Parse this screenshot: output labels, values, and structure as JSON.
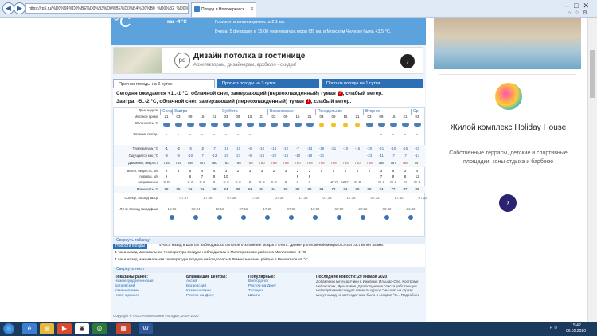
{
  "browser": {
    "url": "https://rp5.ru/%D0%9F%D0%BE%D0%B3%D0%BE%D0%B4%D0%B0_%D0%B2_%D0%9D%D0%BE",
    "tab_title": "Погода в Новочеркасск...",
    "back": "◀",
    "forward": "▶"
  },
  "top": {
    "big_temp": "°C",
    "feels_like": "как -4 °C",
    "visibility": "Горизонтальная видимость 2.1 км.",
    "yesterday": "Вчера, 5 февраля, в 15:00 температура моря (89 км, в Морском Чулеке) была +3.5 °C."
  },
  "ad": {
    "logo": "pd",
    "title": "Дизайн потолка в гостинице",
    "subtitle": "Архитекторам, дизайнерам, архбюро - скидки!",
    "go": "›"
  },
  "tabs": [
    {
      "label": "Прогноз погоды на 6 суток",
      "active": true
    },
    {
      "label": "Прогноз погоды на 3 суток"
    },
    {
      "label": "Прогноз погоды на 1 сутки"
    }
  ],
  "summary": {
    "line1_a": "Сегодня ожидается +1..-1 °С, облачной снег, замерзающий (переохлажденный) туман",
    "line1_b": ", слабый ветер.",
    "line2_a": "Завтра: -5..-2 °С, облачной снег, замерзающий (переохлажденный) туман",
    "line2_b": ", слабый ветер.",
    "warn": "!"
  },
  "grid": {
    "labels": {
      "day": "День недели",
      "time": "Местное время",
      "cloud": "Облачность, %",
      "phen": "Явления погоды",
      "temp": "Температура, °С",
      "feels": "Ощущается как, °С",
      "press": "Давление, мм рт.ст.",
      "wind": "Ветер: скорость, м/с",
      "gust": "порывы, м/с",
      "dir": "направление",
      "hum": "Влажность, %",
      "sun": "Солнце: восход заход",
      "moon": "Луна: восход заход фаза"
    },
    "days": [
      "Сегодня",
      "Завтра",
      "Суббота",
      "Воскресенье",
      "Понедельник",
      "Вторник",
      "Ср"
    ],
    "times": [
      "21",
      "03",
      "09",
      "15",
      "21",
      "03",
      "09",
      "15",
      "21",
      "03",
      "09",
      "15",
      "21",
      "03",
      "09",
      "15",
      "21",
      "03",
      "09",
      "15",
      "21",
      "03"
    ],
    "temp": [
      "-1",
      "-2",
      "-5",
      "-2",
      "-7",
      "-16",
      "-16",
      "-6",
      "-10",
      "-14",
      "-12",
      "-7",
      "-13",
      "-18",
      "-21",
      "-10",
      "-16",
      "-20",
      "-21",
      "-10",
      "-15",
      "-22"
    ],
    "feels": [
      "-5",
      "-6",
      "-10",
      "-7",
      "-13",
      "-20",
      "-21",
      "-9",
      "-25",
      "-20",
      "-19",
      "-10",
      "-18",
      "-31",
      "",
      "",
      "",
      "-23",
      "-11",
      "-7",
      "-7",
      "-14"
    ],
    "press": [
      "745",
      "744",
      "746",
      "747",
      "750",
      "752",
      "755",
      "758",
      "760",
      "758",
      "758",
      "760",
      "766",
      "766",
      "766",
      "765",
      "760",
      "758",
      "756",
      "757",
      "758",
      "747"
    ],
    "wind": [
      "5",
      "3",
      "5",
      "4",
      "4",
      "3",
      "2",
      "3",
      "3",
      "2",
      "3",
      "2",
      "2",
      "0",
      "0",
      "0",
      "0",
      "2",
      "3",
      "5",
      "3",
      "4"
    ],
    "gust": [
      "9",
      "",
      "6",
      "7",
      "8",
      "10",
      "",
      "",
      "",
      "",
      "",
      "6",
      "6",
      "",
      "",
      "",
      "",
      "",
      "7",
      "8",
      "8",
      "11"
    ],
    "dir": [
      "С-В",
      "",
      "С-З",
      "С-З",
      "З",
      "С-З",
      "С-З",
      "З",
      "С-З",
      "С-З",
      "З",
      "З",
      "З",
      "",
      "ШТЛ",
      "ШТЛ",
      "Ю-В",
      "",
      "Ю-З",
      "Ю-З",
      "Ю",
      "Ю-В"
    ],
    "hum": [
      "92",
      "95",
      "91",
      "91",
      "92",
      "94",
      "88",
      "81",
      "81",
      "84",
      "93",
      "89",
      "86",
      "81",
      "70",
      "81",
      "80",
      "88",
      "94",
      "77",
      "87",
      "86"
    ],
    "sun": [
      "07:37",
      "17:35",
      "07:38",
      "17:35",
      "07:36",
      "17:35",
      "07:35",
      "17:38",
      "07:33",
      "17:40",
      "07:32",
      "17:42"
    ],
    "moon": [
      "15:06",
      "06:04",
      "16:18",
      "07:15",
      "17:39",
      "07:33",
      "19:00",
      "08:50",
      "22:22",
      "09:02",
      "21:42"
    ]
  },
  "prev": "Свернуть таблицу",
  "news": {
    "header": "Новости погоды",
    "items": [
      "4 часа назад в Шахтах наблюдалось сильное отклонение мокрого слота. Диаметр отложений мокрого слота составлял 35 мм.",
      "4 часа назад минимальная температура воздуха наблюдалась в Миллеровском районе в Миллерово: -4 °С",
      "4 часа назад максимальная температура воздуха наблюдалась в Ремонтненском районе в Ремонтное +5 °С"
    ]
  },
  "prev2": "Свернуть текст",
  "links": {
    "c1": {
      "h": "Показаны ранее:",
      "items": [
        "Нижнекундрюченская",
        "Багаевский",
        "Каменоломни",
        "Новочеркасск"
      ]
    },
    "c2": {
      "h": "Ближайшие центры:",
      "items": [
        "Аксай",
        "Багаевский",
        "Каменоломни",
        "Ростов-на-Дону"
      ]
    },
    "c3": {
      "h": "Популярные:",
      "items": [
        "Волгодонск",
        "Ростов-на-Дону",
        "Таганрог",
        "Шахты"
      ]
    },
    "c4": {
      "h": "Последние новости: 29 января 2020",
      "text": "Добавлены метеодатчики в Ижевске, Ильшар-Оле, Костроме, Чебоксарах, Ярославле. Для получения списка работающих метеодатчиков следует навести курсор \"мышки\" на фразу минут назад на метеодатчике было в сегодня °С... Подробнее"
    }
  },
  "copyright": "Copyright © ООО «Расписание Погоды», 2004-2020",
  "rightad": {
    "title": "Жилой комплекс Holiday House",
    "text": "Собственные террасы, детские и спортивные площадки, зоны отдыха и барбекю",
    "go": "›"
  },
  "taskbar": {
    "time": "15:42",
    "date": "06.02.2020",
    "lang": "RU"
  }
}
